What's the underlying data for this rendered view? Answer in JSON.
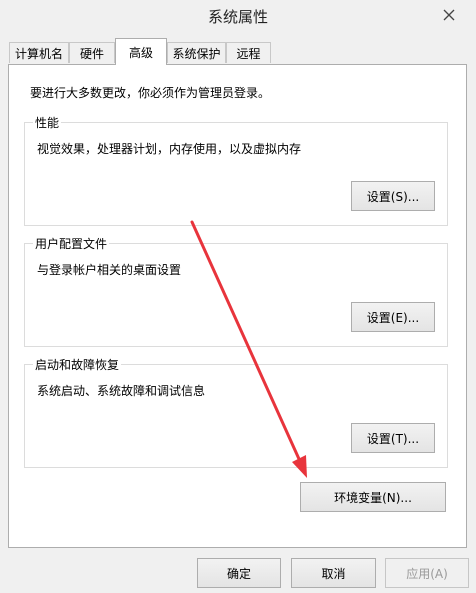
{
  "window": {
    "title": "系统属性",
    "close_icon": "close-icon"
  },
  "tabs": [
    {
      "label": "计算机名",
      "active": false
    },
    {
      "label": "硬件",
      "active": false
    },
    {
      "label": "高级",
      "active": true
    },
    {
      "label": "系统保护",
      "active": false
    },
    {
      "label": "远程",
      "active": false
    }
  ],
  "advanced": {
    "admin_note": "要进行大多数更改，你必须作为管理员登录。",
    "performance": {
      "title": "性能",
      "description": "视觉效果，处理器计划，内存使用，以及虚拟内存",
      "button": "设置(S)..."
    },
    "user_profiles": {
      "title": "用户配置文件",
      "description": "与登录帐户相关的桌面设置",
      "button": "设置(E)..."
    },
    "startup_recovery": {
      "title": "启动和故障恢复",
      "description": "系统启动、系统故障和调试信息",
      "button": "设置(T)..."
    },
    "env_button": "环境变量(N)..."
  },
  "footer": {
    "ok": "确定",
    "cancel": "取消",
    "apply": "应用(A)"
  },
  "annotation": {
    "arrow_color": "#e8343c"
  }
}
